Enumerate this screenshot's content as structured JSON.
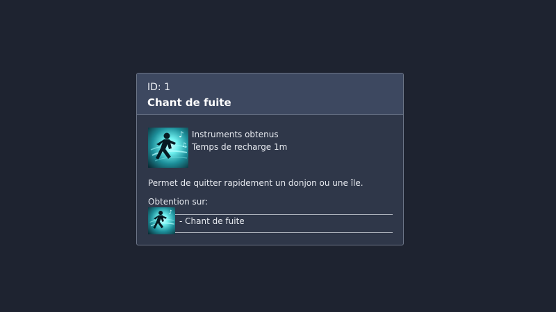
{
  "tooltip": {
    "id_label": "ID: 1",
    "title": "Chant de fuite",
    "skill": {
      "icon": "running-figure-icon",
      "lines": [
        "Instruments obtenus",
        "Temps de recharge 1m"
      ]
    },
    "description": "Permet de quitter rapidement un donjon ou une île.",
    "obtention": {
      "label": "Obtention sur:",
      "items": [
        {
          "icon": "running-figure-icon",
          "label": "- Chant de fuite"
        }
      ]
    }
  },
  "colors": {
    "background": "#1e2330",
    "panel": "#2f3749",
    "header": "#3d4860",
    "border": "#6c7587",
    "icon_glow": "#35d6d8"
  }
}
